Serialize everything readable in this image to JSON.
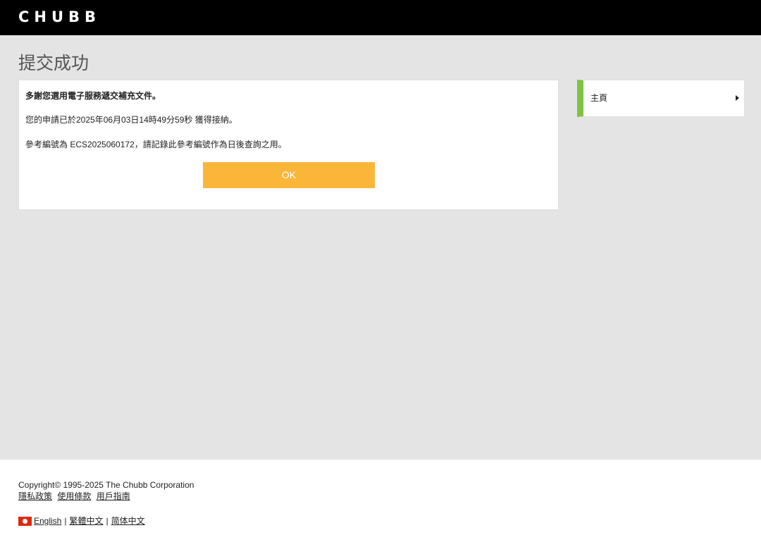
{
  "header": {
    "logo_text": "CHUBB"
  },
  "page": {
    "title": "提交成功"
  },
  "message": {
    "line1": "多謝您選用電子服務遞交補充文件。",
    "line2": "您的申請已於2025年06月03日14時49分59秒 獲得接納。",
    "line3": "參考編號為 ECS2025060172，請記錄此參考編號作為日後查詢之用。",
    "ok_label": "OK"
  },
  "side_nav": {
    "home_label": "主頁"
  },
  "footer": {
    "copyright": "Copyright© 1995-2025 The Chubb Corporation",
    "links": [
      "隱私政策",
      "使用條款",
      "用戶指南"
    ],
    "languages": [
      "English",
      "繁體中文",
      "简体中文"
    ],
    "separator": "|"
  },
  "colors": {
    "ok_button": "#fbb63a",
    "nav_accent": "#80c342",
    "header_bg": "#000000",
    "page_bg": "#e4e4e4"
  }
}
